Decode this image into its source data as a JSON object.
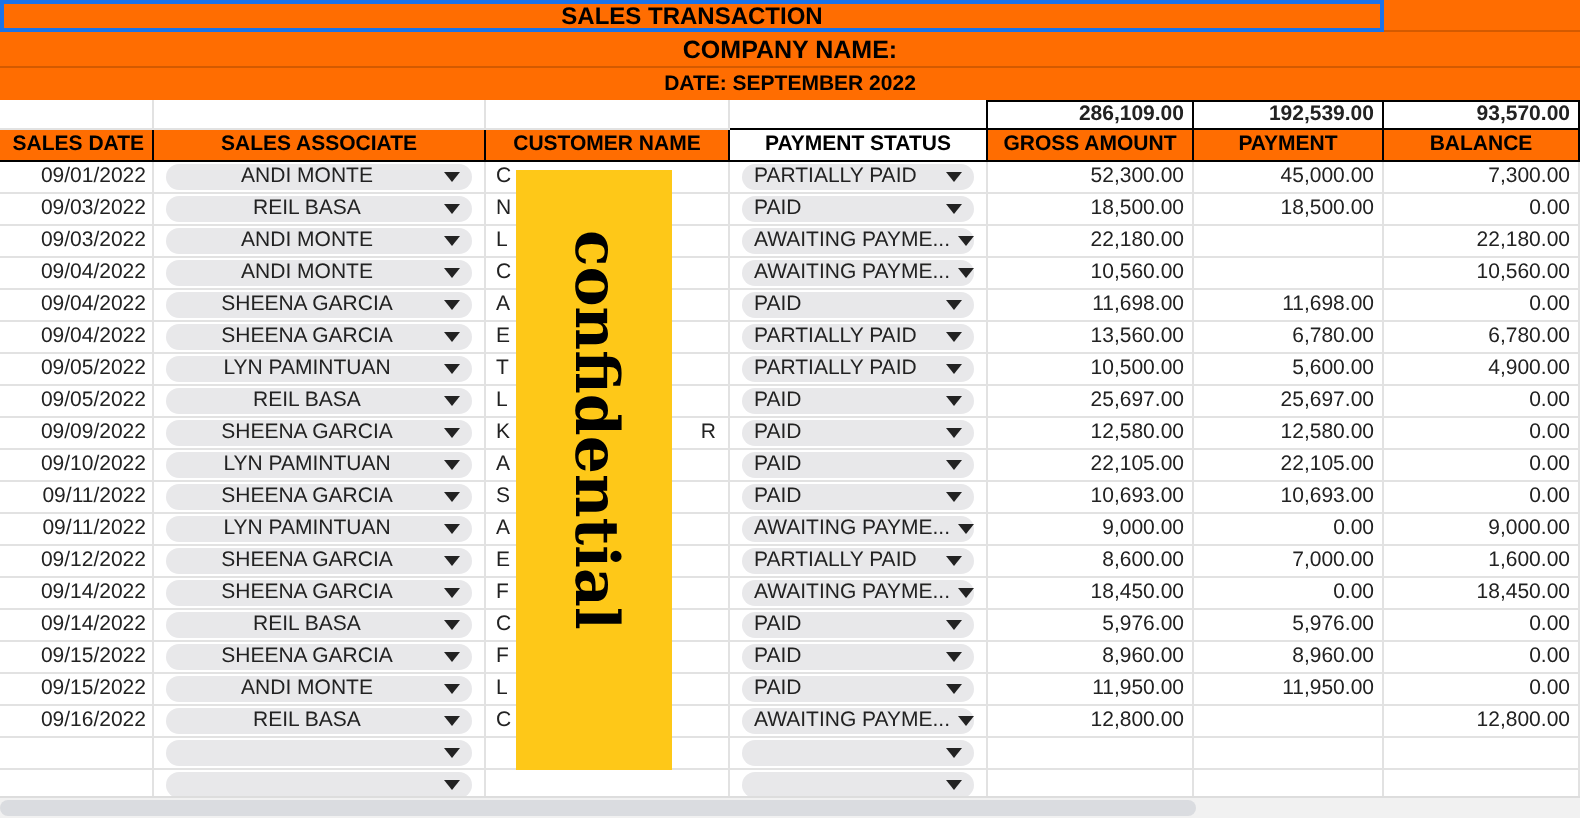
{
  "title": "SALES TRANSACTION",
  "company": "COMPANY NAME:",
  "date": "DATE: SEPTEMBER 2022",
  "totals": {
    "gross": "286,109.00",
    "payment": "192,539.00",
    "balance": "93,570.00"
  },
  "columns": [
    "SALES DATE",
    "SALES ASSOCIATE",
    "CUSTOMER NAME",
    "PAYMENT STATUS",
    "GROSS AMOUNT",
    "PAYMENT",
    "BALANCE"
  ],
  "rows": [
    {
      "kind": "entry",
      "date": "09/01/2022",
      "associate": "ANDI MONTE",
      "customer": "C",
      "status": "PARTIALLY PAID",
      "gross": "52,300.00",
      "payment": "45,000.00",
      "balance": "7,300.00"
    },
    {
      "kind": "entry",
      "date": "09/03/2022",
      "associate": "REIL BASA",
      "customer": "N",
      "status": "PAID",
      "gross": "18,500.00",
      "payment": "18,500.00",
      "balance": "0.00"
    },
    {
      "kind": "entry",
      "date": "09/03/2022",
      "associate": "ANDI MONTE",
      "customer": "L",
      "status": "AWAITING PAYME...",
      "gross": "22,180.00",
      "payment": "",
      "balance": "22,180.00"
    },
    {
      "kind": "entry",
      "date": "09/04/2022",
      "associate": "ANDI MONTE",
      "customer": "C",
      "status": "AWAITING PAYME...",
      "gross": "10,560.00",
      "payment": "",
      "balance": "10,560.00"
    },
    {
      "kind": "entry",
      "date": "09/04/2022",
      "associate": "SHEENA GARCIA",
      "customer": "A",
      "status": "PAID",
      "gross": "11,698.00",
      "payment": "11,698.00",
      "balance": "0.00"
    },
    {
      "kind": "entry",
      "date": "09/04/2022",
      "associate": "SHEENA GARCIA",
      "customer": "E",
      "status": "PARTIALLY PAID",
      "gross": "13,560.00",
      "payment": "6,780.00",
      "balance": "6,780.00"
    },
    {
      "kind": "entry",
      "date": "09/05/2022",
      "associate": "LYN PAMINTUAN",
      "customer": "T",
      "status": "PARTIALLY PAID",
      "gross": "10,500.00",
      "payment": "5,600.00",
      "balance": "4,900.00"
    },
    {
      "kind": "entry",
      "date": "09/05/2022",
      "associate": "REIL BASA",
      "customer": "L",
      "status": "PAID",
      "gross": "25,697.00",
      "payment": "25,697.00",
      "balance": "0.00"
    },
    {
      "kind": "entry",
      "date": "09/09/2022",
      "associate": "SHEENA GARCIA",
      "customer": "K",
      "customer_end": "R",
      "status": "PAID",
      "gross": "12,580.00",
      "payment": "12,580.00",
      "balance": "0.00"
    },
    {
      "kind": "entry",
      "date": "09/10/2022",
      "associate": "LYN PAMINTUAN",
      "customer": "A",
      "status": "PAID",
      "gross": "22,105.00",
      "payment": "22,105.00",
      "balance": "0.00"
    },
    {
      "kind": "entry",
      "date": "09/11/2022",
      "associate": "SHEENA GARCIA",
      "customer": "S",
      "status": "PAID",
      "gross": "10,693.00",
      "payment": "10,693.00",
      "balance": "0.00"
    },
    {
      "kind": "entry",
      "date": "09/11/2022",
      "associate": "LYN PAMINTUAN",
      "customer": "A",
      "status": "AWAITING PAYME...",
      "gross": "9,000.00",
      "payment": "0.00",
      "balance": "9,000.00"
    },
    {
      "kind": "entry",
      "date": "09/12/2022",
      "associate": "SHEENA GARCIA",
      "customer": "E",
      "status": "PARTIALLY PAID",
      "gross": "8,600.00",
      "payment": "7,000.00",
      "balance": "1,600.00"
    },
    {
      "kind": "entry",
      "date": "09/14/2022",
      "associate": "SHEENA GARCIA",
      "customer": "F",
      "status": "AWAITING PAYME...",
      "gross": "18,450.00",
      "payment": "0.00",
      "balance": "18,450.00"
    },
    {
      "kind": "entry",
      "date": "09/14/2022",
      "associate": "REIL BASA",
      "customer": "C",
      "status": "PAID",
      "gross": "5,976.00",
      "payment": "5,976.00",
      "balance": "0.00"
    },
    {
      "kind": "entry",
      "date": "09/15/2022",
      "associate": "SHEENA GARCIA",
      "customer": "F",
      "status": "PAID",
      "gross": "8,960.00",
      "payment": "8,960.00",
      "balance": "0.00"
    },
    {
      "kind": "entry",
      "date": "09/15/2022",
      "associate": "ANDI MONTE",
      "customer": "L",
      "status": "PAID",
      "gross": "11,950.00",
      "payment": "11,950.00",
      "balance": "0.00"
    },
    {
      "kind": "entry",
      "date": "09/16/2022",
      "associate": "REIL BASA",
      "customer": "C",
      "status": "AWAITING PAYME...",
      "gross": "12,800.00",
      "payment": "",
      "balance": "12,800.00"
    },
    {
      "kind": "blank"
    },
    {
      "kind": "blank"
    }
  ],
  "overlay": {
    "label": "confidential"
  }
}
